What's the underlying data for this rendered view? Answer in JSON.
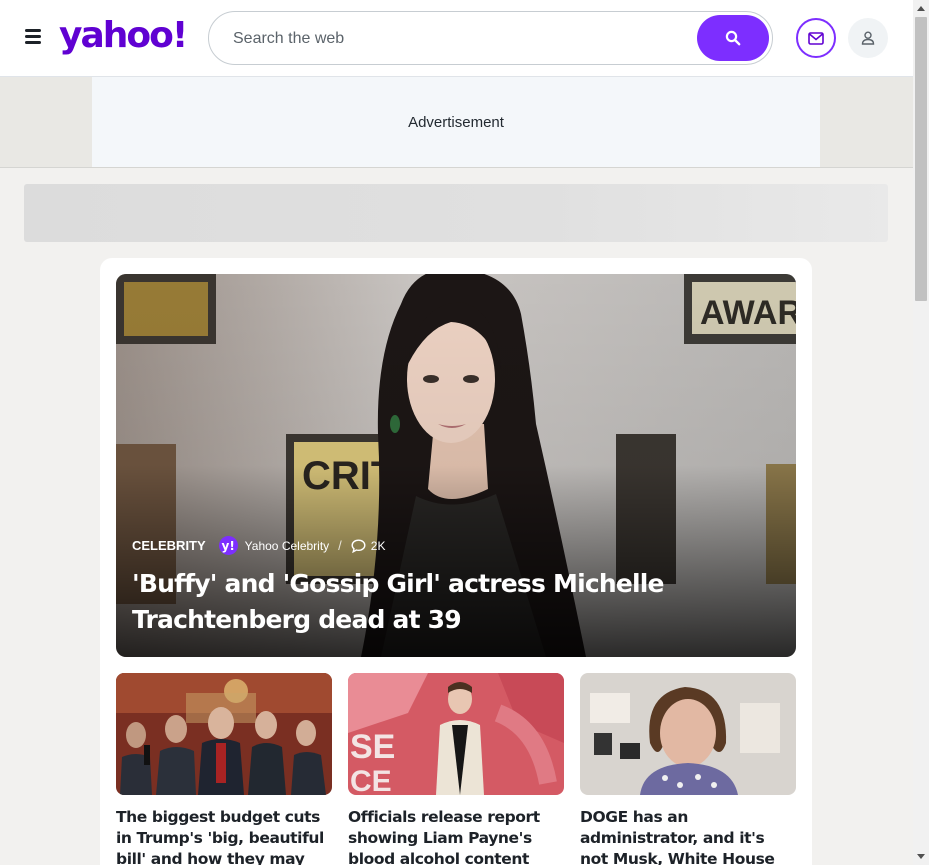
{
  "header": {
    "logo_text": "yahoo!",
    "search_placeholder": "Search the web",
    "search_value": "",
    "brand_color": "#6001d2",
    "accent_color": "#7d2eff",
    "icons": [
      "menu-icon",
      "search-icon",
      "mail-icon",
      "user-icon"
    ]
  },
  "ad": {
    "label": "Advertisement"
  },
  "hero": {
    "category": "CELEBRITY",
    "provider_logo_letter": "y!",
    "provider": "Yahoo Celebrity",
    "separator": "/",
    "comments": "2K",
    "title": "'Buffy' and 'Gossip Girl' actress Michelle Trachtenberg dead at 39"
  },
  "stories": [
    {
      "title": "The biggest budget cuts in Trump's 'big, beautiful bill' and how they may affect"
    },
    {
      "title": "Officials release report showing Liam Payne's blood alcohol content when he"
    },
    {
      "title": "DOGE has an administrator, and it's not Musk, White House confirms"
    }
  ]
}
